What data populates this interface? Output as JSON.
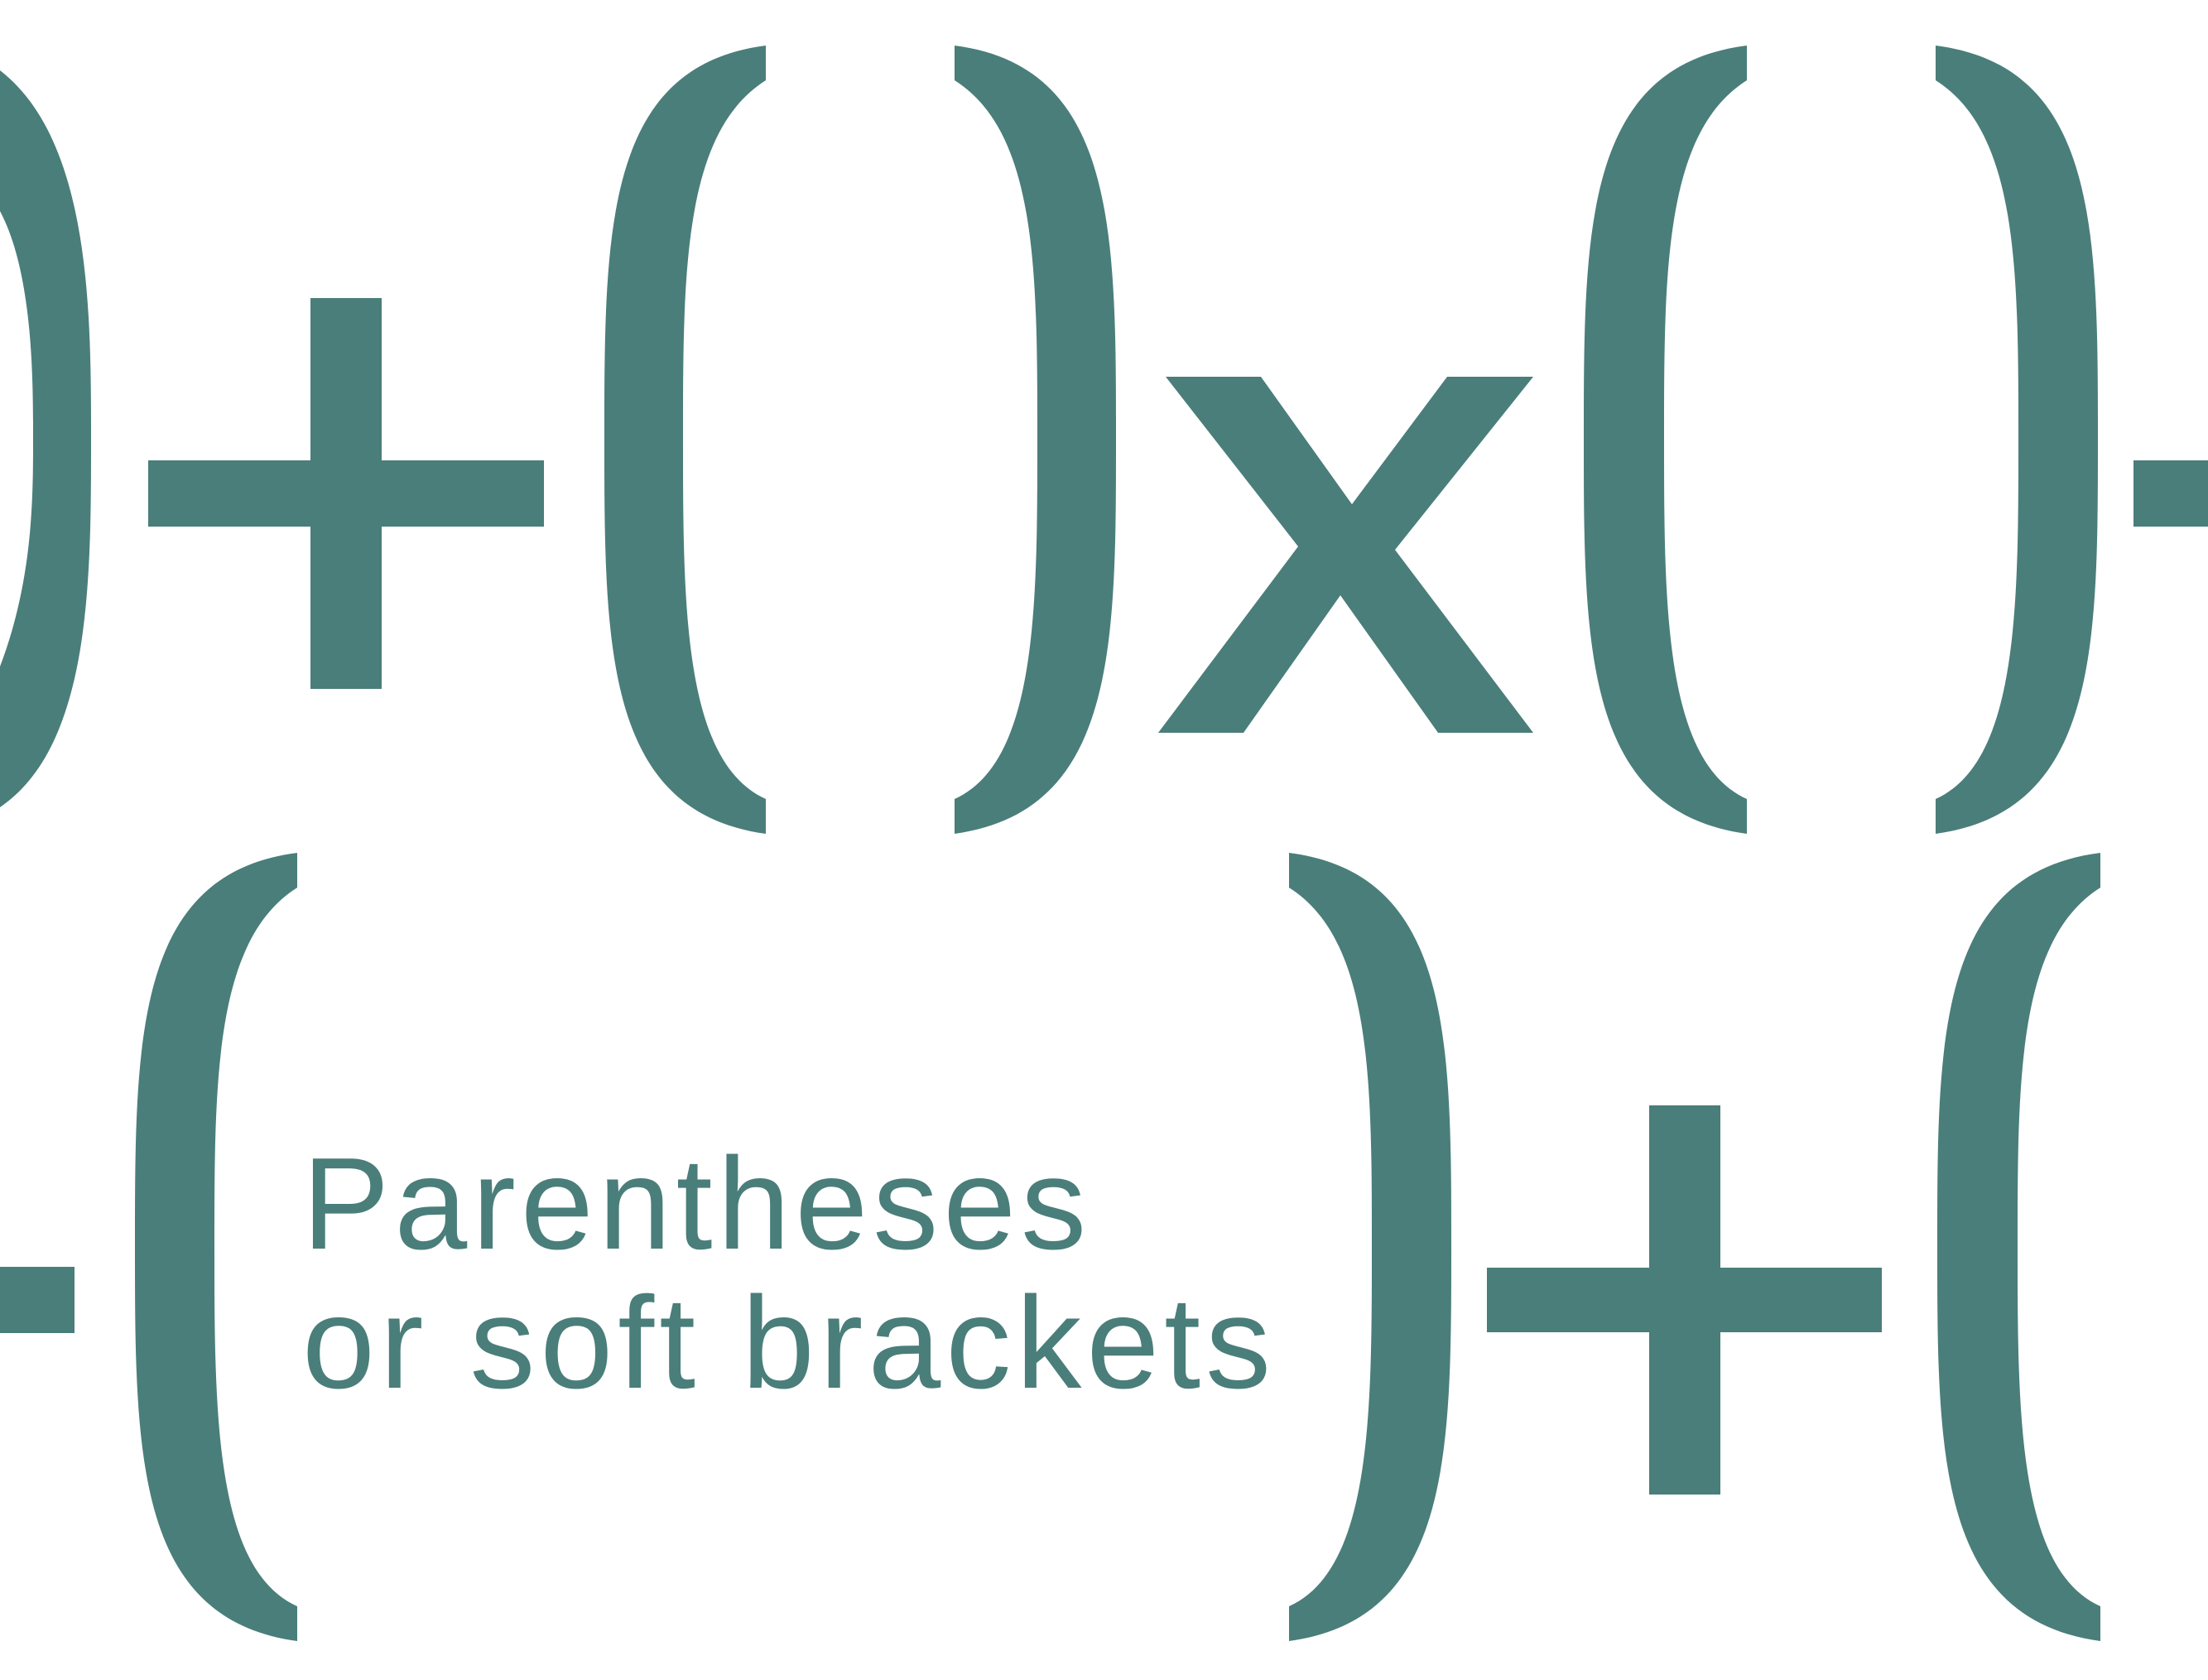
{
  "colors": {
    "ink": "#4a7e7a",
    "background": "#ffffff"
  },
  "caption": {
    "line1": "Parentheses",
    "line2": "or soft brackets"
  },
  "glyphs": {
    "row1": [
      "right-parenthesis",
      "plus-sign",
      "left-parenthesis",
      "right-parenthesis",
      "multiplication-sign",
      "left-parenthesis",
      "right-parenthesis",
      "minus-sign"
    ],
    "row2": [
      "minus-sign",
      "left-parenthesis",
      "right-parenthesis",
      "plus-sign",
      "left-parenthesis"
    ]
  }
}
